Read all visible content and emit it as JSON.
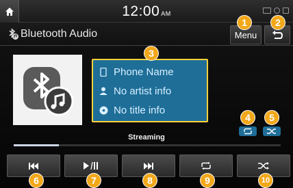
{
  "status": {
    "time": "12:00",
    "ampm": "AM"
  },
  "title": {
    "text": "Bluetooth Audio"
  },
  "header": {
    "menu_label": "Menu"
  },
  "info": {
    "phone": "Phone Name",
    "artist": "No artist info",
    "title": "No title info"
  },
  "playback": {
    "status": "Streaming",
    "progress_fraction": 0.17
  },
  "controls": [
    {
      "name": "previous-button",
      "icon": "previous-icon"
    },
    {
      "name": "play-pause-button",
      "icon": "play-pause-icon"
    },
    {
      "name": "next-button",
      "icon": "next-icon"
    },
    {
      "name": "repeat-button",
      "icon": "repeat-icon"
    },
    {
      "name": "shuffle-button",
      "icon": "shuffle-icon"
    }
  ],
  "callouts": [
    "1",
    "2",
    "3",
    "4",
    "5",
    "6",
    "7",
    "8",
    "9",
    "10"
  ],
  "colors": {
    "accent_blue": "#1e6e98",
    "callout_orange": "#f2a81a",
    "highlight_yellow": "#ffd23a"
  }
}
